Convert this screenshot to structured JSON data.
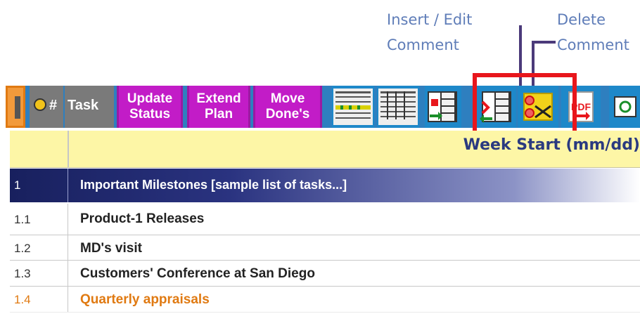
{
  "callouts": {
    "insert_line1": "Insert / Edit",
    "insert_line2": "Comment",
    "delete_line1": "Delete",
    "delete_line2": "Comment"
  },
  "toolbar": {
    "hash_label": "#",
    "task_label": "Task",
    "buttons": [
      {
        "line1": "Update",
        "line2": "Status"
      },
      {
        "line1": "Extend",
        "line2": "Plan"
      },
      {
        "line1": "Move",
        "line2": "Done's"
      }
    ],
    "icons": [
      "calendar-expand-icon",
      "calendar-grid-icon",
      "insert-column-icon",
      "delete-column-icon",
      "comment-edit-icon",
      "pdf-export-icon",
      "camera-icon"
    ]
  },
  "header": {
    "week_start": "Week Start (mm/dd)"
  },
  "rows": [
    {
      "num": "1",
      "text": "Important Milestones [sample list of tasks...]"
    },
    {
      "num": "1.1",
      "text": "Product-1 Releases"
    },
    {
      "num": "1.2",
      "text": "MD's visit"
    },
    {
      "num": "1.3",
      "text": "Customers' Conference at San Diego"
    },
    {
      "num": "1.4",
      "text": "Quarterly appraisals"
    }
  ],
  "colors": {
    "magenta_button": "#c21cc7",
    "toolbar_blue": "#2e7fbf",
    "week_header_yellow": "#fdf6a6",
    "section_navy": "#18205e",
    "highlight_red": "#e8161c",
    "orange_text": "#e07a12"
  }
}
